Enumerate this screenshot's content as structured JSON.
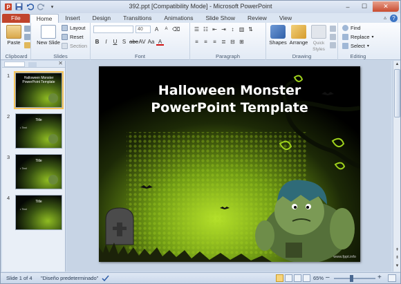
{
  "window": {
    "title": "392.ppt [Compatibility Mode] - Microsoft PowerPoint",
    "controls": [
      "minimize",
      "maximize",
      "close"
    ]
  },
  "qat": [
    "save-icon",
    "undo-icon",
    "redo-icon",
    "customize-icon"
  ],
  "tabs": [
    {
      "label": "File"
    },
    {
      "label": "Home"
    },
    {
      "label": "Insert"
    },
    {
      "label": "Design"
    },
    {
      "label": "Transitions"
    },
    {
      "label": "Animations"
    },
    {
      "label": "Slide Show"
    },
    {
      "label": "Review"
    },
    {
      "label": "View"
    }
  ],
  "ribbon": {
    "clipboard": {
      "label": "Clipboard",
      "paste": "Paste"
    },
    "slides": {
      "label": "Slides",
      "new_slide": "New Slide",
      "layout": "Layout",
      "reset": "Reset",
      "section": "Section"
    },
    "font": {
      "label": "Font",
      "size": "40"
    },
    "paragraph": {
      "label": "Paragraph"
    },
    "drawing": {
      "label": "Drawing",
      "shapes": "Shapes",
      "arrange": "Arrange",
      "quick_styles": "Quick Styles"
    },
    "editing": {
      "label": "Editing",
      "find": "Find",
      "replace": "Replace",
      "select": "Select"
    }
  },
  "thumbnails": [
    {
      "num": "1",
      "title": "Halloween Monster PowerPoint Template",
      "text": ""
    },
    {
      "num": "2",
      "title": "Title",
      "text": "• Text"
    },
    {
      "num": "3",
      "title": "Title",
      "text": "• Text"
    },
    {
      "num": "4",
      "title": "Title",
      "text": "• Text"
    }
  ],
  "slide": {
    "title_line1": "Halloween Monster",
    "title_line2": "PowerPoint Template",
    "url": "www.fppt.info"
  },
  "status": {
    "slide_info": "Slide 1 of 4",
    "theme": "\"Diseño predeterminado\"",
    "zoom": "65%"
  },
  "colors": {
    "file_tab": "#c1442c",
    "slide_glow": "#9bd21a",
    "selection": "#f6c55a"
  }
}
